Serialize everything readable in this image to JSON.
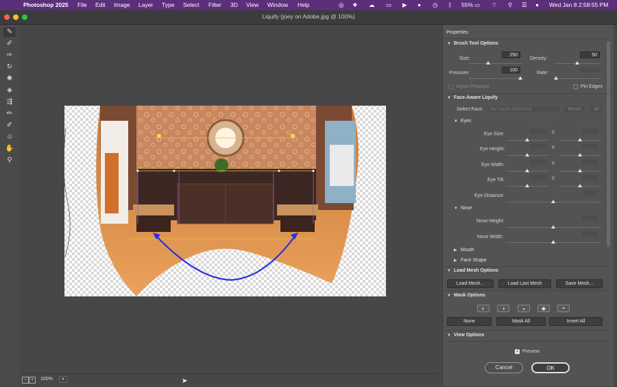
{
  "menubar": {
    "app_name": "Photoshop 2025",
    "items": [
      "File",
      "Edit",
      "Image",
      "Layer",
      "Type",
      "Select",
      "Filter",
      "3D",
      "View",
      "Window",
      "Help"
    ],
    "battery": "55%",
    "clock": "Wed Jan 8  2:58:55 PM"
  },
  "window": {
    "title": "Liquify (joey on Adobe.jpg @ 100%)"
  },
  "status": {
    "zoom": "100%"
  },
  "properties": {
    "title": "Properties",
    "brush": {
      "header": "Brush Tool Options",
      "size_label": "Size:",
      "size_value": "250",
      "density_label": "Density:",
      "density_value": "50",
      "pressure_label": "Pressure:",
      "pressure_value": "100",
      "rate_label": "Rate:",
      "stylus_label": "Stylus Pressure",
      "pin_edges_label": "Pin Edges"
    },
    "face": {
      "header": "Face-Aware Liquify",
      "select_face_label": "Select Face:",
      "select_face_value": "No Faces Detected",
      "reset_label": "Reset",
      "all_label": "All",
      "eyes_header": "Eyes",
      "eye_size_label": "Eye Size:",
      "eye_height_label": "Eye Height:",
      "eye_width_label": "Eye Width:",
      "eye_tilt_label": "Eye Tilt:",
      "eye_distance_label": "Eye Distance:",
      "nose_header": "Nose",
      "nose_height_label": "Nose Height:",
      "nose_width_label": "Nose Width:",
      "mouth_header": "Mouth",
      "face_shape_header": "Face Shape"
    },
    "load_mesh": {
      "header": "Load Mesh Options",
      "load_mesh": "Load Mesh...",
      "load_last_mesh": "Load Last Mesh",
      "save_mesh": "Save Mesh..."
    },
    "mask": {
      "header": "Mask Options",
      "none": "None",
      "mask_all": "Mask All",
      "invert_all": "Invert All"
    },
    "view": {
      "header": "View Options"
    },
    "preview_label": "Preview",
    "cancel": "Cancel",
    "ok": "OK"
  },
  "colors": {
    "menubar_bg": "#5b2f7a",
    "ok_border": "#e0e0e0",
    "arrow_blue": "#2b2ee0"
  },
  "icons": [
    "apple-icon",
    "wifi-icon",
    "bluetooth-icon",
    "search-icon",
    "hand-icon",
    "zoom-icon"
  ]
}
